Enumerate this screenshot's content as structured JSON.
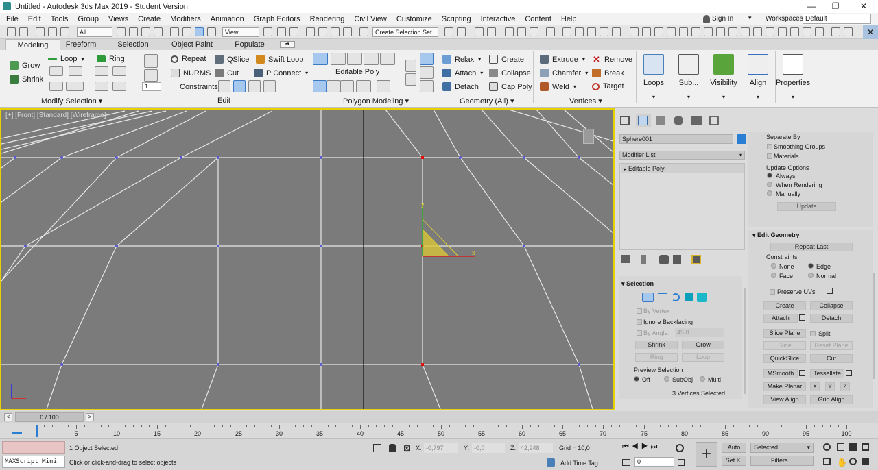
{
  "title": "Untitled - Autodesk 3ds Max 2019 - Student Version",
  "window": {
    "minimize": "—",
    "maximize": "❐",
    "close": "✕"
  },
  "menu": [
    "File",
    "Edit",
    "Tools",
    "Group",
    "Views",
    "Create",
    "Modifiers",
    "Animation",
    "Graph Editors",
    "Rendering",
    "Civil View",
    "Customize",
    "Scripting",
    "Interactive",
    "Content",
    "Help"
  ],
  "user": {
    "sign_in": "Sign In",
    "workspaces_label": "Workspaces:",
    "workspace": "Default"
  },
  "toolbar": {
    "selection_filter": "All",
    "ref_coord": "View",
    "named_selection": "Create Selection Set"
  },
  "ribbon_tabs": [
    "Modeling",
    "Freeform",
    "Selection",
    "Object Paint",
    "Populate"
  ],
  "ribbon": {
    "modify_selection": {
      "label": "Modify Selection",
      "grow": "Grow",
      "shrink": "Shrink",
      "loop": "Loop",
      "ring": "Ring"
    },
    "edit": {
      "label": "Edit",
      "repeat": "Repeat",
      "qslice": "QSlice",
      "swift_loop": "Swift Loop",
      "nurms": "NURMS",
      "cut": "Cut",
      "p_connect": "P Connect",
      "constraints": "Constraints:",
      "spinner": "1"
    },
    "polygon_modeling": {
      "label": "Polygon Modeling",
      "editable_poly": "Editable Poly"
    },
    "geometry_all": {
      "label": "Geometry (All)",
      "relax": "Relax",
      "create": "Create",
      "attach": "Attach",
      "collapse": "Collapse",
      "detach": "Detach",
      "cap_poly": "Cap Poly"
    },
    "vertices": {
      "label": "Vertices",
      "extrude": "Extrude",
      "remove": "Remove",
      "chamfer": "Chamfer",
      "break": "Break",
      "weld": "Weld",
      "target": "Target"
    },
    "big": [
      "Loops",
      "Sub...",
      "Visibility",
      "Align",
      "Properties"
    ]
  },
  "viewport": {
    "label": "[+] [Front] [Standard] [Wireframe]"
  },
  "command_panel": {
    "object_name": "Sphere001",
    "object_color": "#2a7fd4",
    "modifier_list": "Modifier List",
    "stack_item": "Editable Poly",
    "selection": {
      "title": "Selection",
      "by_vertex": "By Vertex",
      "ignore_backfacing": "Ignore Backfacing",
      "by_angle": "By Angle:",
      "angle": "45,0",
      "shrink": "Shrink",
      "grow": "Grow",
      "ring": "Ring",
      "loop": "Loop",
      "preview_selection": "Preview Selection",
      "off": "Off",
      "subobj": "SubObj",
      "multi": "Multi",
      "status": "3 Vertices Selected"
    },
    "right": {
      "separate_by": "Separate By",
      "smoothing_groups": "Smoothing Groups",
      "materials": "Materials",
      "update_options": "Update Options",
      "always": "Always",
      "when_rendering": "When Rendering",
      "manually": "Manually",
      "update": "Update"
    },
    "edit_geometry": {
      "title": "Edit Geometry",
      "repeat_last": "Repeat Last",
      "constraints": "Constraints",
      "none": "None",
      "edge": "Edge",
      "face": "Face",
      "normal": "Normal",
      "preserve_uvs": "Preserve UVs",
      "create": "Create",
      "collapse": "Collapse",
      "attach": "Attach",
      "detach": "Detach",
      "slice_plane": "Slice Plane",
      "split": "Split",
      "slice": "Slice",
      "reset_plane": "Reset Plane",
      "quickslice": "QuickSlice",
      "cut": "Cut",
      "msmooth": "MSmooth",
      "tessellate": "Tessellate",
      "make_planar": "Make Planar",
      "x": "X",
      "y": "Y",
      "z": "Z",
      "view_align": "View Align",
      "grid_align": "Grid Align"
    }
  },
  "time": {
    "slider": "0 / 100",
    "ticks": [
      "0",
      "5",
      "10",
      "15",
      "20",
      "25",
      "30",
      "35",
      "40",
      "45",
      "50",
      "55",
      "60",
      "65",
      "70",
      "75",
      "80",
      "85",
      "90",
      "95",
      "100"
    ]
  },
  "status": {
    "maxscript": "MAXScript Mini",
    "objects_selected": "1 Object Selected",
    "prompt": "Click or click-and-drag to select objects",
    "x_label": "X:",
    "x": "-0,797",
    "y_label": "Y:",
    "y": "-0,0",
    "z_label": "Z:",
    "z": "42,948",
    "grid": "Grid = 10,0",
    "add_time_tag": "Add Time Tag",
    "auto": "Auto",
    "set_k": "Set K.",
    "key_mode": "Selected",
    "filters": "Filters...",
    "frame": "0"
  }
}
